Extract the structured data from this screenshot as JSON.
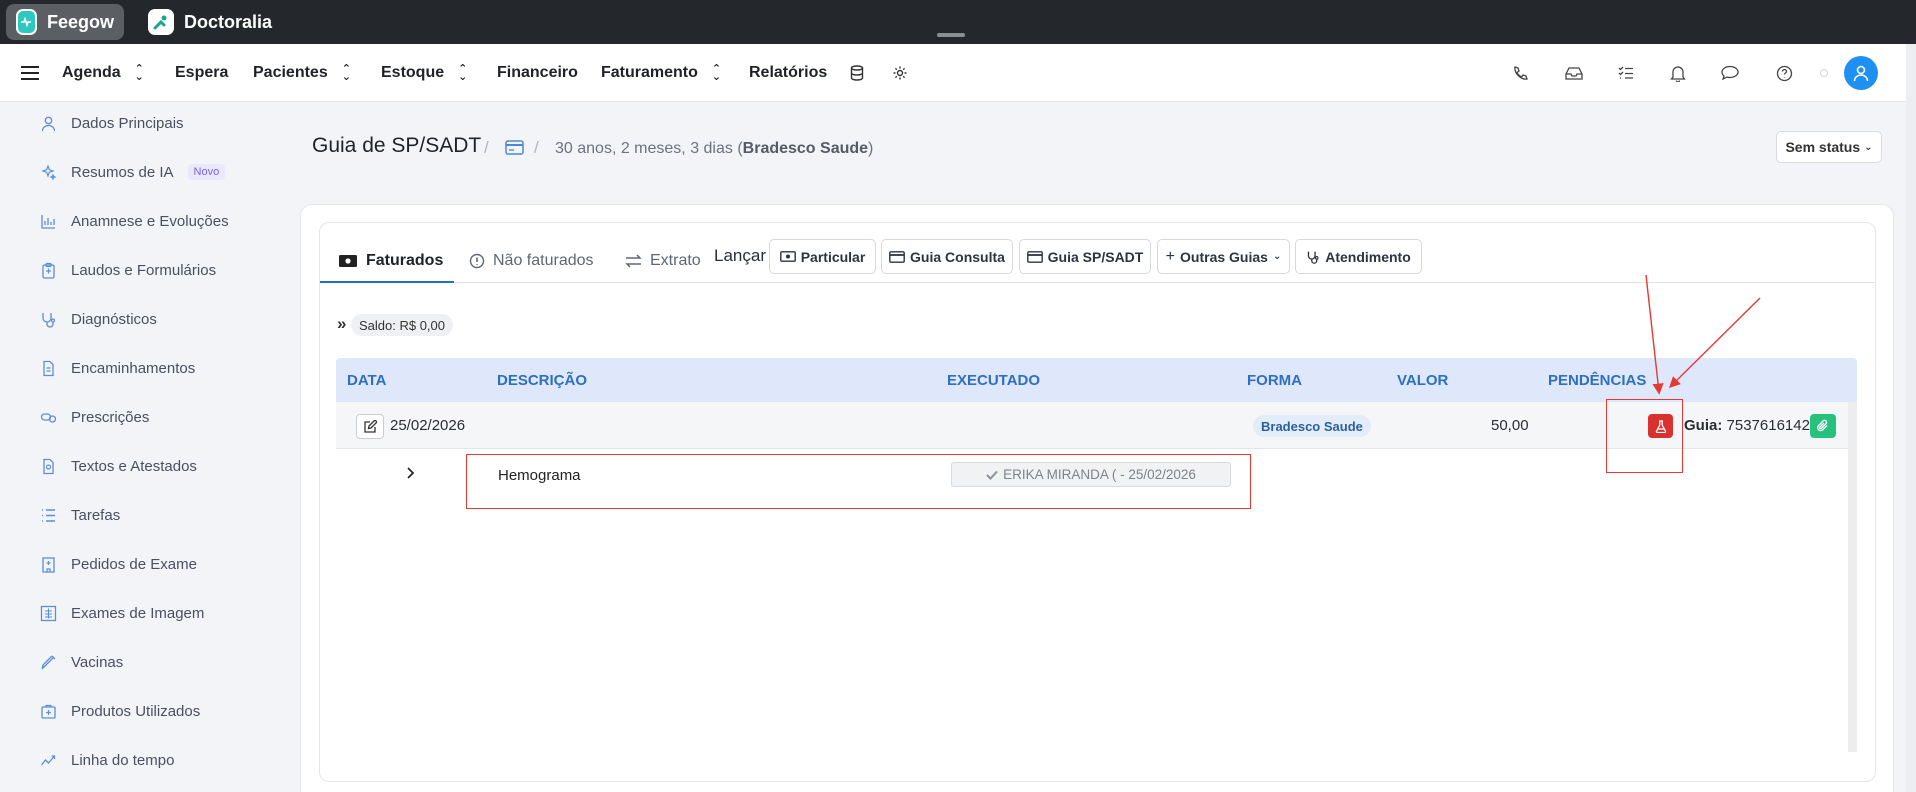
{
  "topbar": {
    "tabs": [
      {
        "label": "Feegow"
      },
      {
        "label": "Doctoralia"
      }
    ]
  },
  "nav": {
    "items": [
      {
        "label": "Agenda"
      },
      {
        "label": "Espera"
      },
      {
        "label": "Pacientes"
      },
      {
        "label": "Estoque"
      },
      {
        "label": "Financeiro"
      },
      {
        "label": "Faturamento"
      },
      {
        "label": "Relatórios"
      }
    ],
    "icons": [
      "database-icon",
      "gear-icon",
      "phone-icon",
      "inbox-icon",
      "checklist-icon",
      "bell-icon",
      "chat-icon",
      "help-icon",
      "user-icon"
    ]
  },
  "sidebar": {
    "items": [
      {
        "label": "Dados Principais",
        "icon": "user-icon"
      },
      {
        "label": "Resumos de IA",
        "badge": "Novo",
        "icon": "sparkles-icon"
      },
      {
        "label": "Anamnese e Evoluções",
        "icon": "chart-icon"
      },
      {
        "label": "Laudos e Formulários",
        "icon": "clipboard-icon"
      },
      {
        "label": "Diagnósticos",
        "icon": "stethoscope-icon"
      },
      {
        "label": "Encaminhamentos",
        "icon": "file-icon"
      },
      {
        "label": "Prescrições",
        "icon": "pills-icon"
      },
      {
        "label": "Textos e Atestados",
        "icon": "document-icon"
      },
      {
        "label": "Tarefas",
        "icon": "list-icon"
      },
      {
        "label": "Pedidos de Exame",
        "icon": "hospital-icon"
      },
      {
        "label": "Exames de Imagem",
        "icon": "xray-icon"
      },
      {
        "label": "Vacinas",
        "icon": "syringe-icon"
      },
      {
        "label": "Produtos Utilizados",
        "icon": "box-icon"
      },
      {
        "label": "Linha do tempo",
        "icon": "timeline-icon"
      }
    ]
  },
  "header": {
    "title": "Guia de SP/SADT",
    "patient_age": "30 anos, 2 meses, 3 dias (",
    "insurer": "Bradesco Saude",
    "patient_close": ")",
    "status_label": "Sem status"
  },
  "tabs": [
    {
      "label": "Faturados",
      "active": true
    },
    {
      "label": "Não faturados"
    },
    {
      "label": "Extrato"
    }
  ],
  "launch": {
    "label": "Lançar",
    "buttons": [
      {
        "label": "Particular"
      },
      {
        "label": "Guia Consulta"
      },
      {
        "label": "Guia SP/SADT"
      },
      {
        "label": "Outras Guias"
      },
      {
        "label": "Atendimento"
      }
    ]
  },
  "saldo": {
    "arrow": "»",
    "label": "Saldo: R$ 0,00"
  },
  "table": {
    "headers": [
      "DATA",
      "DESCRIÇÃO",
      "EXECUTADO",
      "FORMA",
      "VALOR",
      "PENDÊNCIAS"
    ],
    "row": {
      "date": "25/02/2026",
      "forma": "Bradesco Saude",
      "valor": "50,00",
      "guia_label": "Guia:",
      "guia_number": "7537616142"
    },
    "subrow": {
      "description": "Hemograma",
      "executed": "ERIKA MIRANDA ( - 25/02/2026"
    }
  },
  "colors": {
    "accent": "#1f6fd1",
    "header_bg": "#dfe8fb",
    "danger": "#d9322e",
    "success": "#27c07d",
    "annotation": "#e53935"
  }
}
